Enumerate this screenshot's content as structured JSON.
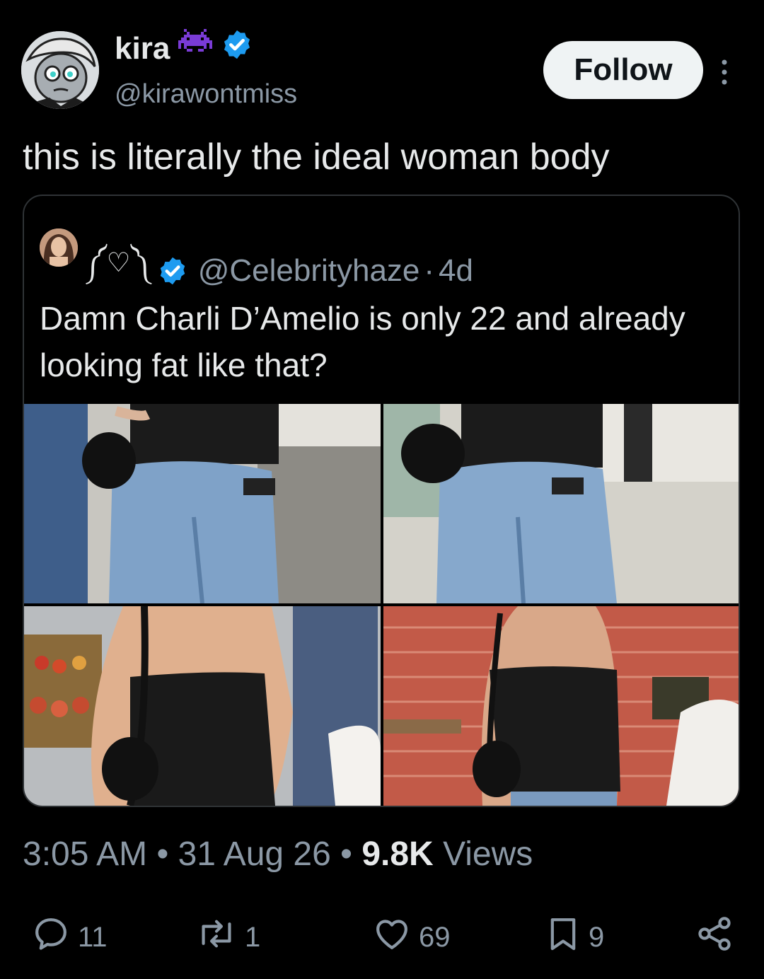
{
  "tweet": {
    "author_name": "kira",
    "author_handle": "@kirawontmiss",
    "follow_label": "Follow",
    "text": "this is literally the ideal woman body",
    "time": "3:05 AM",
    "separator": "•",
    "date": "31 Aug 26",
    "views_count": "9.8K",
    "views_label": "Views"
  },
  "quote": {
    "decoration": "༼♡༽",
    "handle": "@Celebrityhaze",
    "dot": "·",
    "age": "4d",
    "text": "Damn Charli D’Amelio is only 22 and already looking fat like that?"
  },
  "actions": {
    "replies": "11",
    "reposts": "1",
    "likes": "69",
    "bookmarks": "9"
  },
  "colors": {
    "background": "#000000",
    "text": "#e7e9ea",
    "secondary": "#8b98a5",
    "verified": "#1d9bf0",
    "border": "#2f3336"
  }
}
